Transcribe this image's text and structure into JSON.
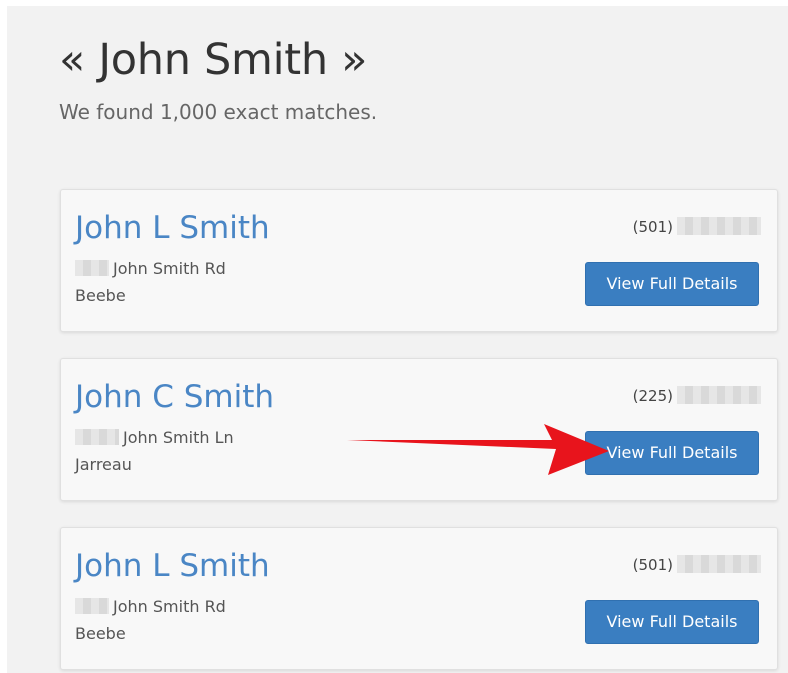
{
  "search": {
    "title": "« John Smith »",
    "match_count_text": "We found 1,000 exact matches."
  },
  "results": [
    {
      "name": "John L Smith",
      "street": "John Smith Rd",
      "city": "Beebe",
      "phone_area": "(501)",
      "button_label": "View Full Details"
    },
    {
      "name": "John C Smith",
      "street": "John Smith Ln",
      "city": "Jarreau",
      "phone_area": "(225)",
      "button_label": "View Full Details"
    },
    {
      "name": "John L Smith",
      "street": "John Smith Rd",
      "city": "Beebe",
      "phone_area": "(501)",
      "button_label": "View Full Details"
    }
  ],
  "colors": {
    "link": "#4a86c5",
    "button": "#3a7ec1",
    "annotation_arrow": "#e8141c"
  },
  "icons": {
    "annotation": "red-arrow-icon"
  }
}
